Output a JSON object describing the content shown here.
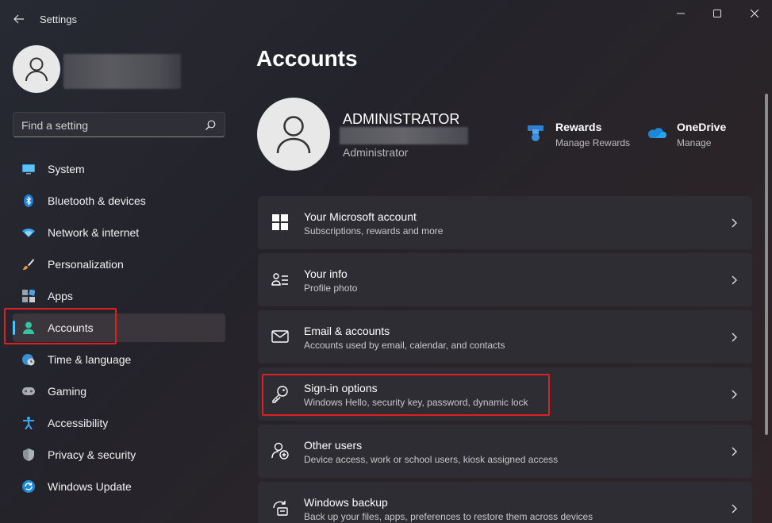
{
  "window": {
    "title": "Settings",
    "back_icon": "back-arrow-icon",
    "minimize_icon": "minimize-icon",
    "maximize_icon": "maximize-icon",
    "close_icon": "close-icon"
  },
  "search": {
    "placeholder": "Find a setting",
    "icon": "search-icon"
  },
  "sidebar": {
    "items": [
      {
        "label": "System",
        "icon": "monitor-icon",
        "selected": false
      },
      {
        "label": "Bluetooth & devices",
        "icon": "bluetooth-icon",
        "selected": false
      },
      {
        "label": "Network & internet",
        "icon": "wifi-icon",
        "selected": false
      },
      {
        "label": "Personalization",
        "icon": "paintbrush-icon",
        "selected": false
      },
      {
        "label": "Apps",
        "icon": "apps-icon",
        "selected": false
      },
      {
        "label": "Accounts",
        "icon": "person-icon",
        "selected": true
      },
      {
        "label": "Time & language",
        "icon": "globe-clock-icon",
        "selected": false
      },
      {
        "label": "Gaming",
        "icon": "gamepad-icon",
        "selected": false
      },
      {
        "label": "Accessibility",
        "icon": "accessibility-icon",
        "selected": false
      },
      {
        "label": "Privacy & security",
        "icon": "shield-icon",
        "selected": false
      },
      {
        "label": "Windows Update",
        "icon": "update-icon",
        "selected": false
      }
    ]
  },
  "main": {
    "title": "Accounts",
    "account": {
      "name": "ADMINISTRATOR",
      "role": "Administrator"
    },
    "quick_links": [
      {
        "title": "Rewards",
        "subtitle": "Manage Rewards",
        "icon": "rewards-medal-icon"
      },
      {
        "title": "OneDrive",
        "subtitle": "Manage",
        "icon": "onedrive-cloud-icon"
      }
    ],
    "cards": [
      {
        "title": "Your Microsoft account",
        "subtitle": "Subscriptions, rewards and more",
        "icon": "windows-logo-icon"
      },
      {
        "title": "Your info",
        "subtitle": "Profile photo",
        "icon": "contact-card-icon"
      },
      {
        "title": "Email & accounts",
        "subtitle": "Accounts used by email, calendar, and contacts",
        "icon": "mail-icon"
      },
      {
        "title": "Sign-in options",
        "subtitle": "Windows Hello, security key, password, dynamic lock",
        "icon": "key-icon"
      },
      {
        "title": "Other users",
        "subtitle": "Device access, work or school users, kiosk assigned access",
        "icon": "add-user-icon"
      },
      {
        "title": "Windows backup",
        "subtitle": "Back up your files, apps, preferences to restore them across devices",
        "icon": "backup-icon"
      }
    ]
  },
  "colors": {
    "accent": "#4cc2ff",
    "highlight_box": "#e02020"
  }
}
